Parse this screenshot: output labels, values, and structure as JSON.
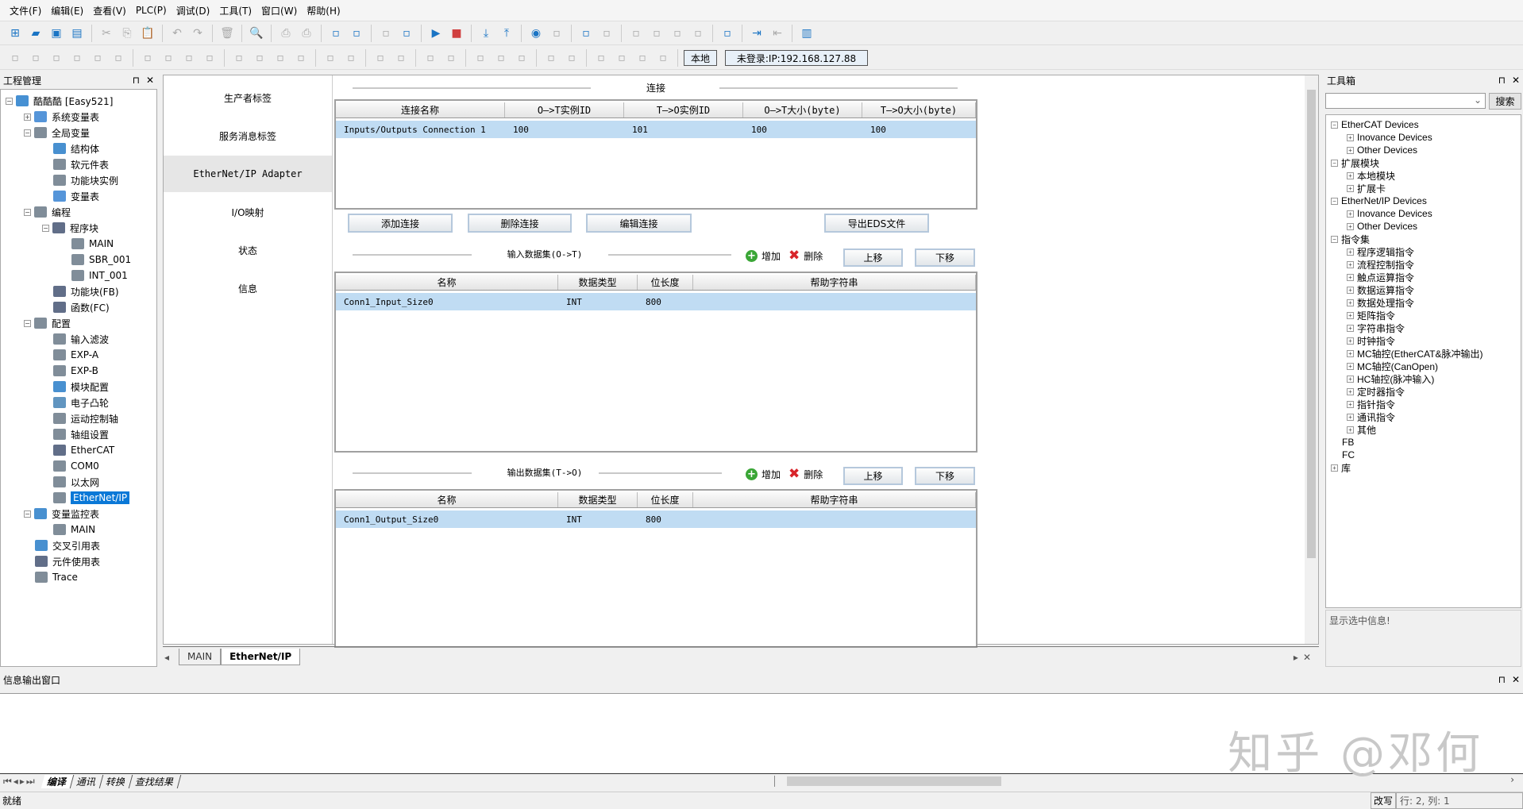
{
  "menu": [
    "文件(F)",
    "编辑(E)",
    "查看(V)",
    "PLC(P)",
    "调试(D)",
    "工具(T)",
    "窗口(W)",
    "帮助(H)"
  ],
  "toolbar1": [
    "new-file",
    "open-folder",
    "save",
    "save-all",
    "|",
    "cut",
    "copy",
    "paste",
    "|",
    "undo",
    "redo",
    "|",
    "delete",
    "|",
    "search",
    "|",
    "print-preview",
    "print",
    "|",
    "window-cascade",
    "window-switch",
    "|",
    "import",
    "export-table",
    "|",
    "run",
    "stop",
    "|",
    "download",
    "upload",
    "|",
    "monitor",
    "trace",
    "|",
    "debug-edit",
    "edit",
    "|",
    "grid-a",
    "grid-b",
    "align-a",
    "align-b",
    "|",
    "test-usb",
    "|",
    "login",
    "logout",
    "|",
    "panel"
  ],
  "toolbar2": [
    "lad",
    "s-box",
    "s-box2",
    "contact-node",
    "arrow-down-filled",
    "arrow-down",
    "|",
    "branch-a",
    "branch-b",
    "branch-c",
    "branch-d",
    "|",
    "line-right",
    "line-up",
    "corner-down",
    "corner-up",
    "|",
    "no-contact",
    "nc-contact",
    "|",
    "rise-contact",
    "fall-contact",
    "|",
    "set-coil",
    "c-coil",
    "|",
    "coil",
    "a-box",
    "f-box",
    "|",
    "hline",
    "vline",
    "|",
    "slash",
    "cross",
    "up",
    "down"
  ],
  "toolbar2_buttons": {
    "local": "本地",
    "login_status": "未登录:IP:192.168.127.88"
  },
  "left_panel": {
    "title": "工程管理",
    "pin": "⊓",
    "close": "✕",
    "tree": [
      {
        "label": "酷酷酷 [Easy521]",
        "level": 0,
        "exp": "−",
        "color": "#1874c8"
      },
      {
        "label": "系统变量表",
        "level": 1,
        "exp": "+",
        "color": "#2a7ad0"
      },
      {
        "label": "全局变量",
        "level": 1,
        "exp": "−",
        "color": "#607080"
      },
      {
        "label": "结构体",
        "level": 2,
        "color": "#1a74c4"
      },
      {
        "label": "软元件表",
        "level": 2,
        "color": "#607080"
      },
      {
        "label": "功能块实例",
        "level": 2,
        "color": "#607080"
      },
      {
        "label": "变量表",
        "level": 2,
        "color": "#2a7ad0"
      },
      {
        "label": "编程",
        "level": 1,
        "exp": "−",
        "color": "#607080"
      },
      {
        "label": "程序块",
        "level": 2,
        "exp": "−",
        "color": "#3a4a6a"
      },
      {
        "label": "MAIN",
        "level": 3,
        "color": "#607080"
      },
      {
        "label": "SBR_001",
        "level": 3,
        "color": "#607080"
      },
      {
        "label": "INT_001",
        "level": 3,
        "color": "#607080"
      },
      {
        "label": "功能块(FB)",
        "level": 2,
        "color": "#3a4a6a"
      },
      {
        "label": "函数(FC)",
        "level": 2,
        "color": "#3a4a6a"
      },
      {
        "label": "配置",
        "level": 1,
        "exp": "−",
        "color": "#607080"
      },
      {
        "label": "输入滤波",
        "level": 2,
        "color": "#607080"
      },
      {
        "label": "EXP-A",
        "level": 2,
        "color": "#607080"
      },
      {
        "label": "EXP-B",
        "level": 2,
        "color": "#607080"
      },
      {
        "label": "模块配置",
        "level": 2,
        "color": "#1a74c4"
      },
      {
        "label": "电子凸轮",
        "level": 2,
        "color": "#3a7ab0"
      },
      {
        "label": "运动控制轴",
        "level": 2,
        "color": "#607080"
      },
      {
        "label": "轴组设置",
        "level": 2,
        "color": "#607080"
      },
      {
        "label": "EtherCAT",
        "level": 2,
        "color": "#3a4a6a"
      },
      {
        "label": "COM0",
        "level": 2,
        "color": "#607080"
      },
      {
        "label": "以太网",
        "level": 2,
        "color": "#607080"
      },
      {
        "label": "EtherNet/IP",
        "level": 2,
        "color": "#607080",
        "selected": true
      },
      {
        "label": "变量监控表",
        "level": 1,
        "exp": "−",
        "color": "#1a74c4"
      },
      {
        "label": "MAIN",
        "level": 2,
        "color": "#607080"
      },
      {
        "label": "交叉引用表",
        "level": 1,
        "color": "#1a74c4"
      },
      {
        "label": "元件使用表",
        "level": 1,
        "color": "#3a4a6a"
      },
      {
        "label": "Trace",
        "level": 1,
        "color": "#607080"
      }
    ]
  },
  "nav": [
    "生产者标签",
    "服务消息标签",
    "EtherNet/IP Adapter",
    "I/O映射",
    "状态",
    "信息"
  ],
  "nav_active": 2,
  "connection": {
    "title": "连接",
    "columns": [
      "连接名称",
      "O—>T实例ID",
      "T—>O实例ID",
      "O—>T大小(byte)",
      "T—>O大小(byte)"
    ],
    "rows": [
      [
        "Inputs/Outputs Connection 1",
        "100",
        "101",
        "100",
        "100"
      ]
    ],
    "buttons": {
      "add": "添加连接",
      "delete": "删除连接",
      "edit": "编辑连接",
      "export": "导出EDS文件"
    }
  },
  "input_set": {
    "title": "输入数据集(O->T)",
    "add": "增加",
    "delete": "删除",
    "up": "上移",
    "down": "下移",
    "columns": [
      "名称",
      "数据类型",
      "位长度",
      "帮助字符串"
    ],
    "rows": [
      [
        "Conn1_Input_Size0",
        "INT",
        "800",
        ""
      ]
    ]
  },
  "output_set": {
    "title": "输出数据集(T->O)",
    "add": "增加",
    "delete": "删除",
    "up": "上移",
    "down": "下移",
    "columns": [
      "名称",
      "数据类型",
      "位长度",
      "帮助字符串"
    ],
    "rows": [
      [
        "Conn1_Output_Size0",
        "INT",
        "800",
        ""
      ]
    ]
  },
  "doc_tabs": [
    "MAIN",
    "EtherNet/IP"
  ],
  "right_panel": {
    "title": "工具箱",
    "search_button": "搜索",
    "search_value": "",
    "info": "显示选中信息!",
    "tree": [
      {
        "label": "EtherCAT Devices",
        "level": 0,
        "exp": "−"
      },
      {
        "label": "Inovance Devices",
        "level": 1,
        "exp": "+"
      },
      {
        "label": "Other Devices",
        "level": 1,
        "exp": "+"
      },
      {
        "label": "扩展模块",
        "level": 0,
        "exp": "−"
      },
      {
        "label": "本地模块",
        "level": 1,
        "exp": "+"
      },
      {
        "label": "扩展卡",
        "level": 1,
        "exp": "+"
      },
      {
        "label": "EtherNet/IP Devices",
        "level": 0,
        "exp": "−"
      },
      {
        "label": "Inovance Devices",
        "level": 1,
        "exp": "+"
      },
      {
        "label": "Other Devices",
        "level": 1,
        "exp": "+"
      },
      {
        "label": "指令集",
        "level": 0,
        "exp": "−"
      },
      {
        "label": "程序逻辑指令",
        "level": 1,
        "exp": "+"
      },
      {
        "label": "流程控制指令",
        "level": 1,
        "exp": "+"
      },
      {
        "label": "触点运算指令",
        "level": 1,
        "exp": "+"
      },
      {
        "label": "数据运算指令",
        "level": 1,
        "exp": "+"
      },
      {
        "label": "数据处理指令",
        "level": 1,
        "exp": "+"
      },
      {
        "label": "矩阵指令",
        "level": 1,
        "exp": "+"
      },
      {
        "label": "字符串指令",
        "level": 1,
        "exp": "+"
      },
      {
        "label": "时钟指令",
        "level": 1,
        "exp": "+"
      },
      {
        "label": "MC轴控(EtherCAT&脉冲输出)",
        "level": 1,
        "exp": "+"
      },
      {
        "label": "MC轴控(CanOpen)",
        "level": 1,
        "exp": "+"
      },
      {
        "label": "HC轴控(脉冲输入)",
        "level": 1,
        "exp": "+"
      },
      {
        "label": "定时器指令",
        "level": 1,
        "exp": "+"
      },
      {
        "label": "指针指令",
        "level": 1,
        "exp": "+"
      },
      {
        "label": "通讯指令",
        "level": 1,
        "exp": "+"
      },
      {
        "label": "其他",
        "level": 1,
        "exp": "+"
      },
      {
        "label": "FB",
        "level": 0
      },
      {
        "label": "FC",
        "level": 0
      },
      {
        "label": "库",
        "level": 0,
        "exp": "+"
      }
    ]
  },
  "output_window": {
    "title": "信息输出窗口",
    "tabs": [
      "编译",
      "通讯",
      "转换",
      "查找结果"
    ],
    "watermark": "知乎 @邓何"
  },
  "status": {
    "left": "就绪",
    "mode": "改写",
    "position": "行: 2, 列: 1"
  }
}
